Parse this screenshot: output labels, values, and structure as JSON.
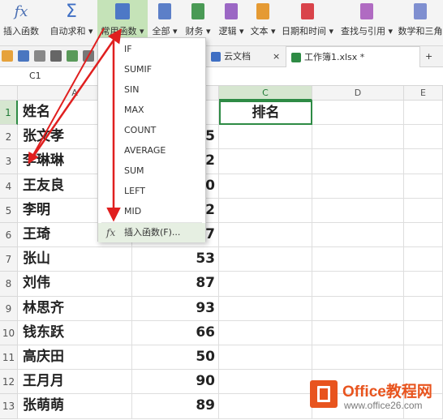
{
  "ribbon": {
    "buttons": [
      {
        "label": "插入函数"
      },
      {
        "label": "自动求和 ▾"
      },
      {
        "label": "常用函数 ▾"
      },
      {
        "label": "全部 ▾"
      },
      {
        "label": "财务 ▾"
      },
      {
        "label": "逻辑 ▾"
      },
      {
        "label": "文本 ▾"
      },
      {
        "label": "日期和时间 ▾"
      },
      {
        "label": "查找与引用 ▾"
      },
      {
        "label": "数学和三角"
      }
    ],
    "fx_glyph": "fx",
    "sigma_glyph": "Σ"
  },
  "tabs": [
    {
      "label": "云文档"
    },
    {
      "label": "工作簿1.xlsx *"
    }
  ],
  "tab_close": "×",
  "tab_add": "+",
  "name_box": "C1",
  "columns": [
    "A",
    "B",
    "C",
    "D",
    "E"
  ],
  "rows": [
    "1",
    "2",
    "3",
    "4",
    "5",
    "6",
    "7",
    "8",
    "9",
    "10",
    "11",
    "12",
    "13"
  ],
  "sheet": {
    "header_name": "姓名",
    "header_rank": "排名",
    "names": [
      "张文孝",
      "李琳琳",
      "王友良",
      "李明",
      "王琦",
      "张山",
      "刘伟",
      "林思齐",
      "钱东跃",
      "高庆田",
      "王月月",
      "张萌萌"
    ],
    "scores": [
      "95",
      "82",
      "40",
      "92",
      "77",
      "53",
      "87",
      "93",
      "66",
      "50",
      "90",
      "89"
    ]
  },
  "menu": {
    "items": [
      "IF",
      "SUMIF",
      "SIN",
      "MAX",
      "COUNT",
      "AVERAGE",
      "SUM",
      "LEFT",
      "MID"
    ],
    "insert_fx": "fx",
    "insert_label": "插入函数(F)..."
  },
  "watermark": {
    "title": "Office教程网",
    "url": "www.office26.com"
  },
  "colors": {
    "accent": "#2e8b45",
    "arrow": "#e01f1f",
    "watermark": "#e8541e"
  }
}
